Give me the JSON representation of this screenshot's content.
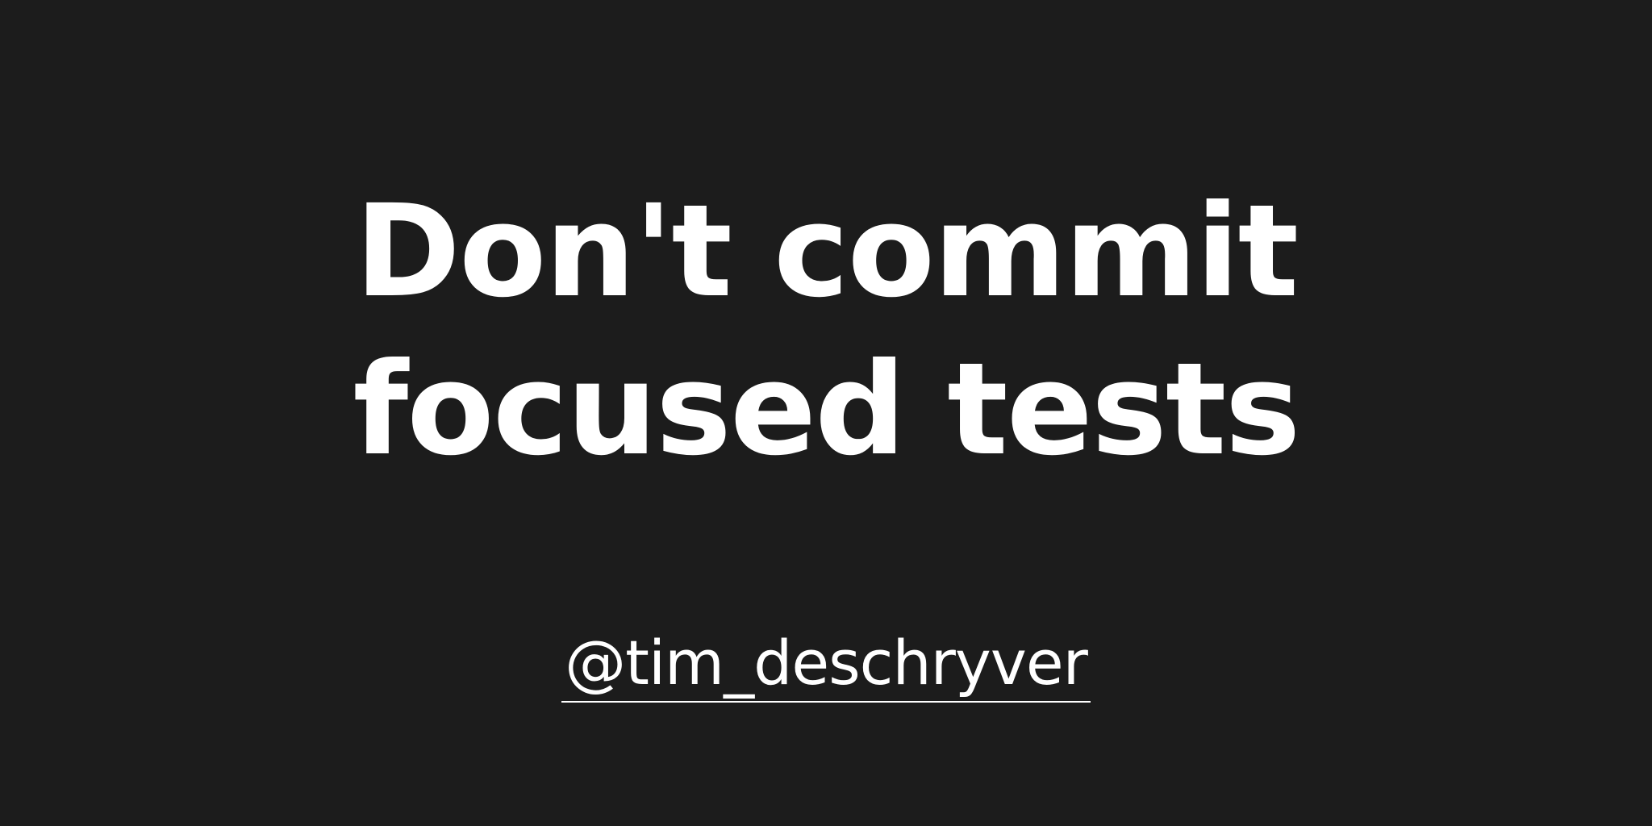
{
  "page": {
    "title": "Don't commit focused tests",
    "author_handle": "@tim_deschryver"
  },
  "colors": {
    "background": "#1c1c1c",
    "text": "#ffffff"
  }
}
